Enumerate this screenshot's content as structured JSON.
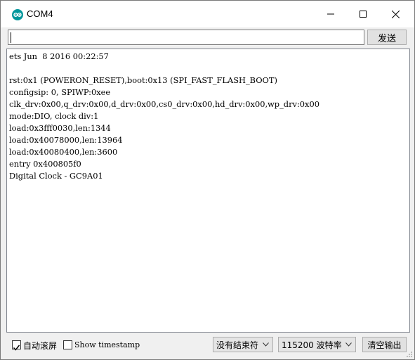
{
  "window": {
    "title": "COM4"
  },
  "send": {
    "input_value": "",
    "button_label": "发送"
  },
  "output": {
    "lines": [
      "ets Jun  8 2016 00:22:57",
      "",
      "rst:0x1 (POWERON_RESET),boot:0x13 (SPI_FAST_FLASH_BOOT)",
      "configsip: 0, SPIWP:0xee",
      "clk_drv:0x00,q_drv:0x00,d_drv:0x00,cs0_drv:0x00,hd_drv:0x00,wp_drv:0x00",
      "mode:DIO, clock div:1",
      "load:0x3fff0030,len:1344",
      "load:0x40078000,len:13964",
      "load:0x40080400,len:3600",
      "entry 0x400805f0",
      "Digital Clock - GC9A01"
    ]
  },
  "bottom": {
    "autoscroll_label": "自动滚屏",
    "autoscroll_checked": true,
    "timestamp_label": "Show timestamp",
    "timestamp_checked": false,
    "line_ending_value": "没有结束符",
    "baud_value": "115200 波特率",
    "clear_label": "清空输出"
  },
  "colors": {
    "accent": "#00979c"
  },
  "icons": {
    "app": "arduino-icon",
    "minimize": "minimize-icon",
    "maximize": "maximize-icon",
    "close": "close-icon",
    "dropdown": "chevron-down-icon",
    "check": "checkmark-icon"
  }
}
